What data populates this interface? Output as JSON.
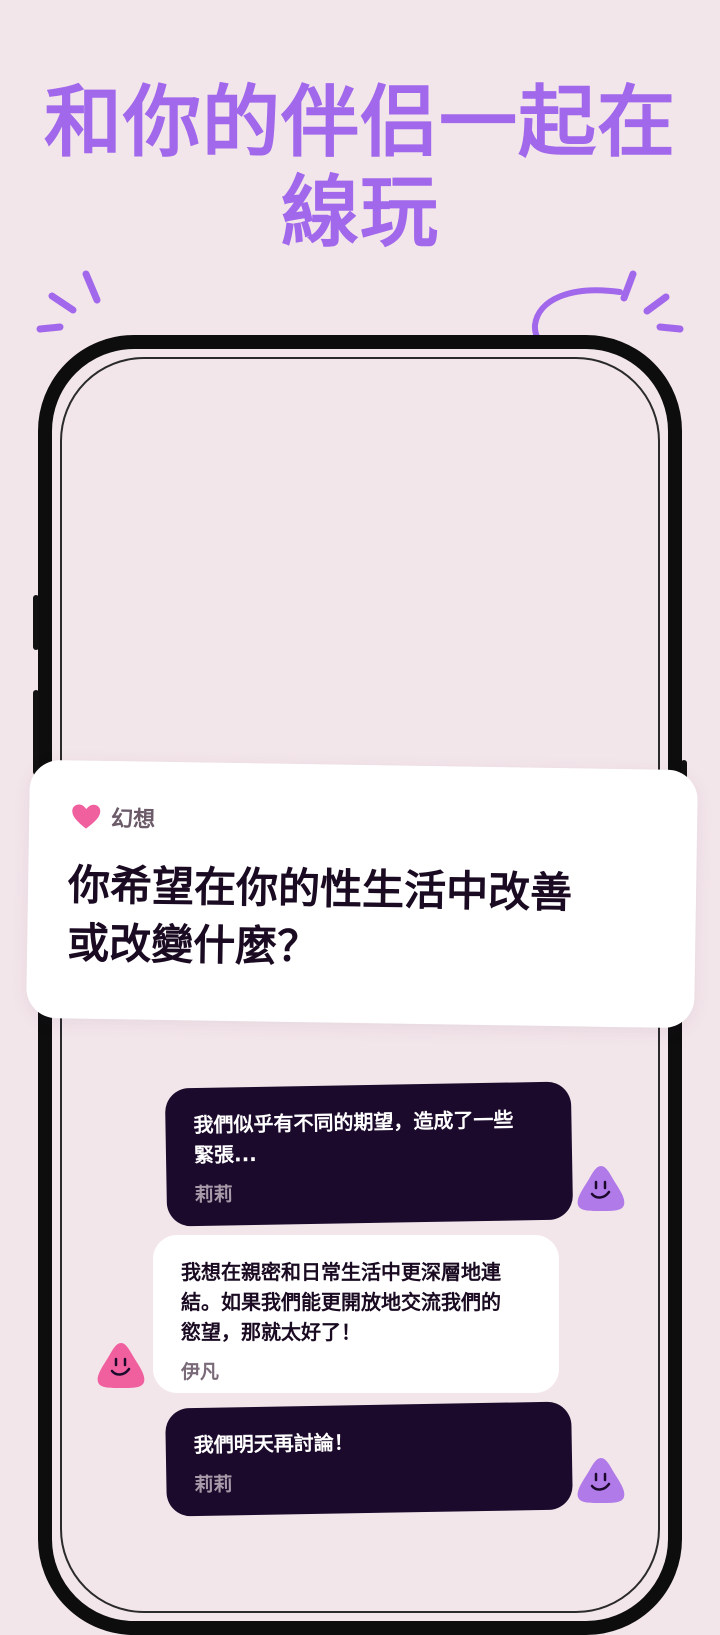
{
  "headline": {
    "line1": "和你的伴侣一起在",
    "line2": "線玩"
  },
  "card": {
    "category": "幻想",
    "category_icon": "heart-icon",
    "question_line1": "你希望在你的性生活中改善",
    "question_line2": "或改變什麼？"
  },
  "messages": [
    {
      "text_line1": "我們似乎有不同的期望，造成了一些",
      "text_line2": "緊張...",
      "author": "莉莉",
      "style": "dark"
    },
    {
      "text_line1": "我想在親密和日常生活中更深層地連",
      "text_line2": "結。如果我們能更開放地交流我們的",
      "text_line3": "慾望，那就太好了！",
      "author": "伊凡",
      "style": "light"
    },
    {
      "text_line1": "我們明天再討論！",
      "author": "莉莉",
      "style": "dark"
    }
  ],
  "colors": {
    "background": "#f3e6ea",
    "accent_purple": "#a268ec",
    "accent_pink": "#f0609f",
    "bubble_dark": "#1c0a2d"
  }
}
